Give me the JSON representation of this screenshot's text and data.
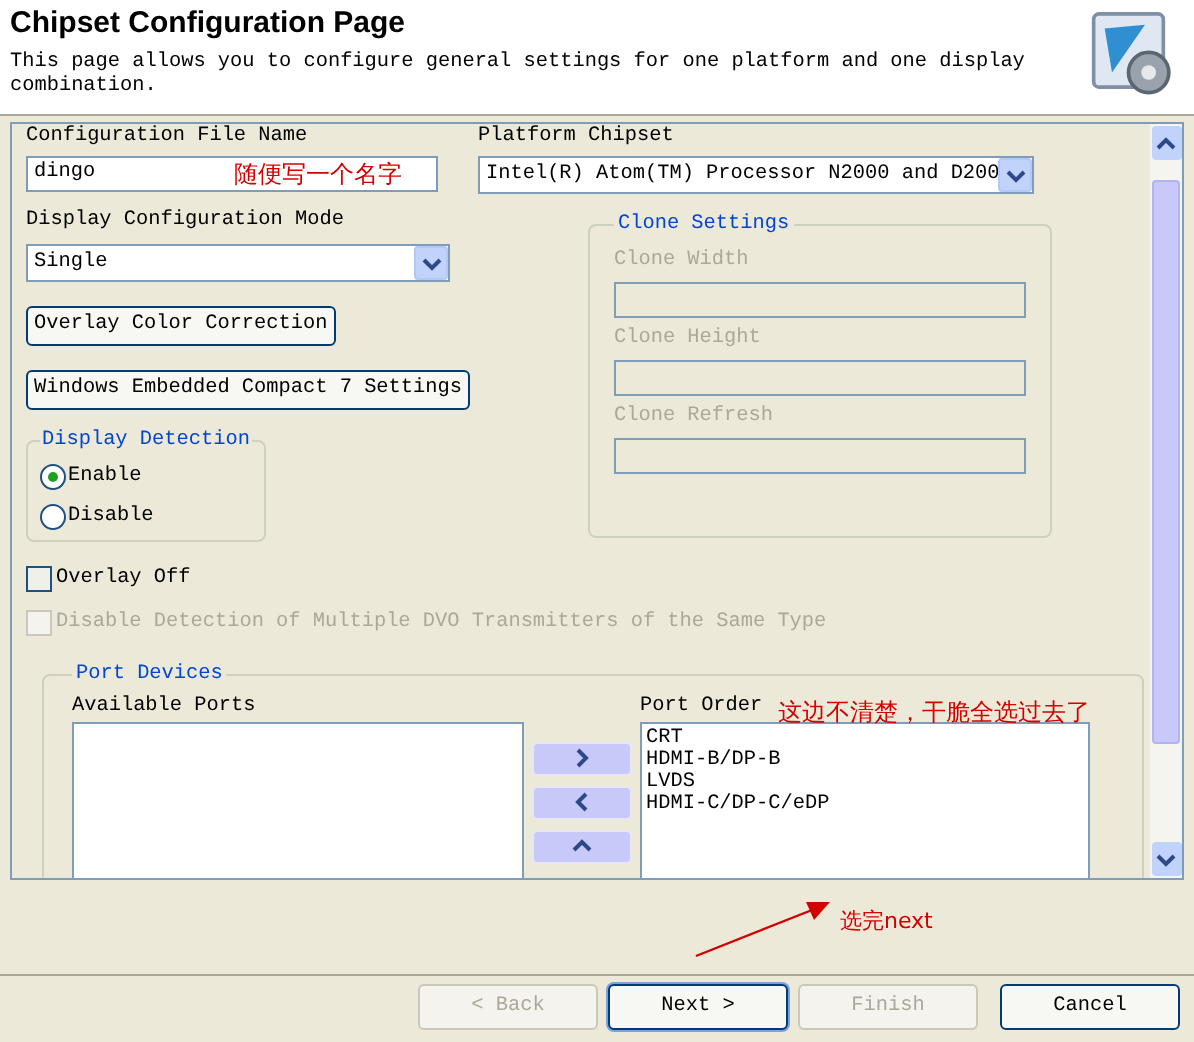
{
  "header": {
    "title": "Chipset Configuration Page",
    "description": "This page allows you to configure general settings for one platform and one display combination."
  },
  "config_file": {
    "label": "Configuration File Name",
    "value": "dingo",
    "note": "随便写一个名字"
  },
  "platform": {
    "label": "Platform Chipset",
    "value": "Intel(R) Atom(TM) Processor N2000 and D200"
  },
  "display_mode": {
    "label": "Display Configuration Mode",
    "value": "Single"
  },
  "action_buttons": [
    "Overlay Color Correction",
    "Windows Embedded Compact 7 Settings"
  ],
  "display_detection": {
    "title": "Display Detection",
    "options": [
      {
        "label": "Enable",
        "selected": true
      },
      {
        "label": "Disable",
        "selected": false
      }
    ]
  },
  "clone_settings": {
    "title": "Clone Settings",
    "disabled": true,
    "fields": [
      {
        "label": "Clone Width"
      },
      {
        "label": "Clone Height"
      },
      {
        "label": "Clone Refresh"
      }
    ]
  },
  "checkboxes": [
    {
      "label": "Overlay Off",
      "checked": false,
      "disabled": false
    },
    {
      "label": "Disable Detection of Multiple DVO Transmitters of the Same Type",
      "checked": false,
      "disabled": true
    }
  ],
  "port_devices": {
    "title": "Port Devices",
    "available_label": "Available Ports",
    "order_label": "Port Order",
    "note": "这边不清楚，干脆全选过去了",
    "order": [
      "CRT",
      "HDMI-B/DP-B",
      "LVDS",
      "HDMI-C/DP-C/eDP"
    ]
  },
  "footer_note": "选完next",
  "wizard_buttons": [
    {
      "label": "< Back",
      "disabled": true,
      "default": false
    },
    {
      "label": "Next >",
      "disabled": false,
      "default": true
    },
    {
      "label": "Finish",
      "disabled": true,
      "default": false
    },
    {
      "label": "Cancel",
      "disabled": false,
      "default": false
    }
  ]
}
